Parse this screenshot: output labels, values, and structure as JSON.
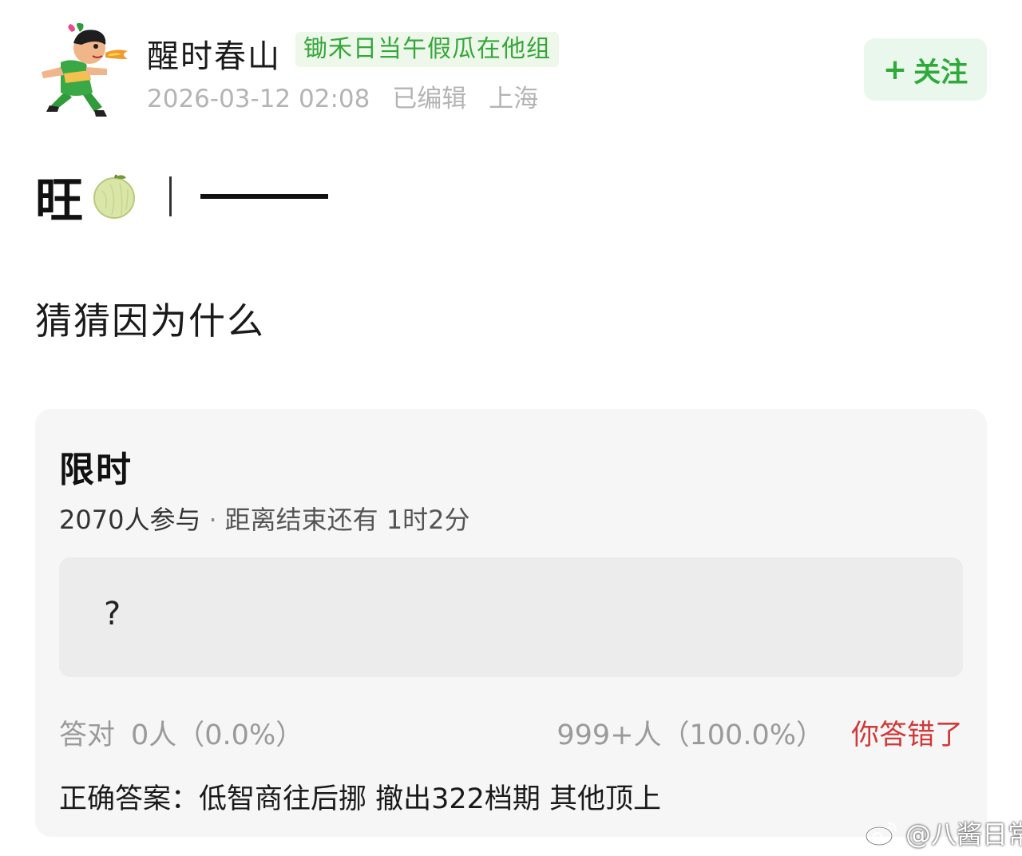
{
  "header": {
    "username": "醒时春山",
    "group_tag": "锄禾日当午假瓜在他组",
    "timestamp": "2026-03-12 02:08",
    "edited": "已编辑",
    "location": "上海",
    "follow": {
      "plus": "+",
      "label": "关注"
    }
  },
  "post": {
    "title": "旺",
    "title_emoji": "melon-icon",
    "body": "猜猜因为什么"
  },
  "quiz": {
    "title": "限时",
    "participants": "2070人参与",
    "separator": "·",
    "remaining": "距离结束还有 1时2分",
    "option": "?",
    "correct_label": "答对",
    "correct_count": "0人（0.0%）",
    "other_count": "999+人（100.0%）",
    "result_status": "你答错了",
    "answer": "正确答案：低智商往后挪 撤出322档期 其他顶上"
  },
  "watermark": {
    "icon": "weibo-icon",
    "text": "@八酱日常"
  },
  "colors": {
    "accent_green": "#2faa3a",
    "tag_bg": "#edf7ea",
    "error_red": "#d03a3a",
    "card_bg": "#f6f6f6"
  }
}
